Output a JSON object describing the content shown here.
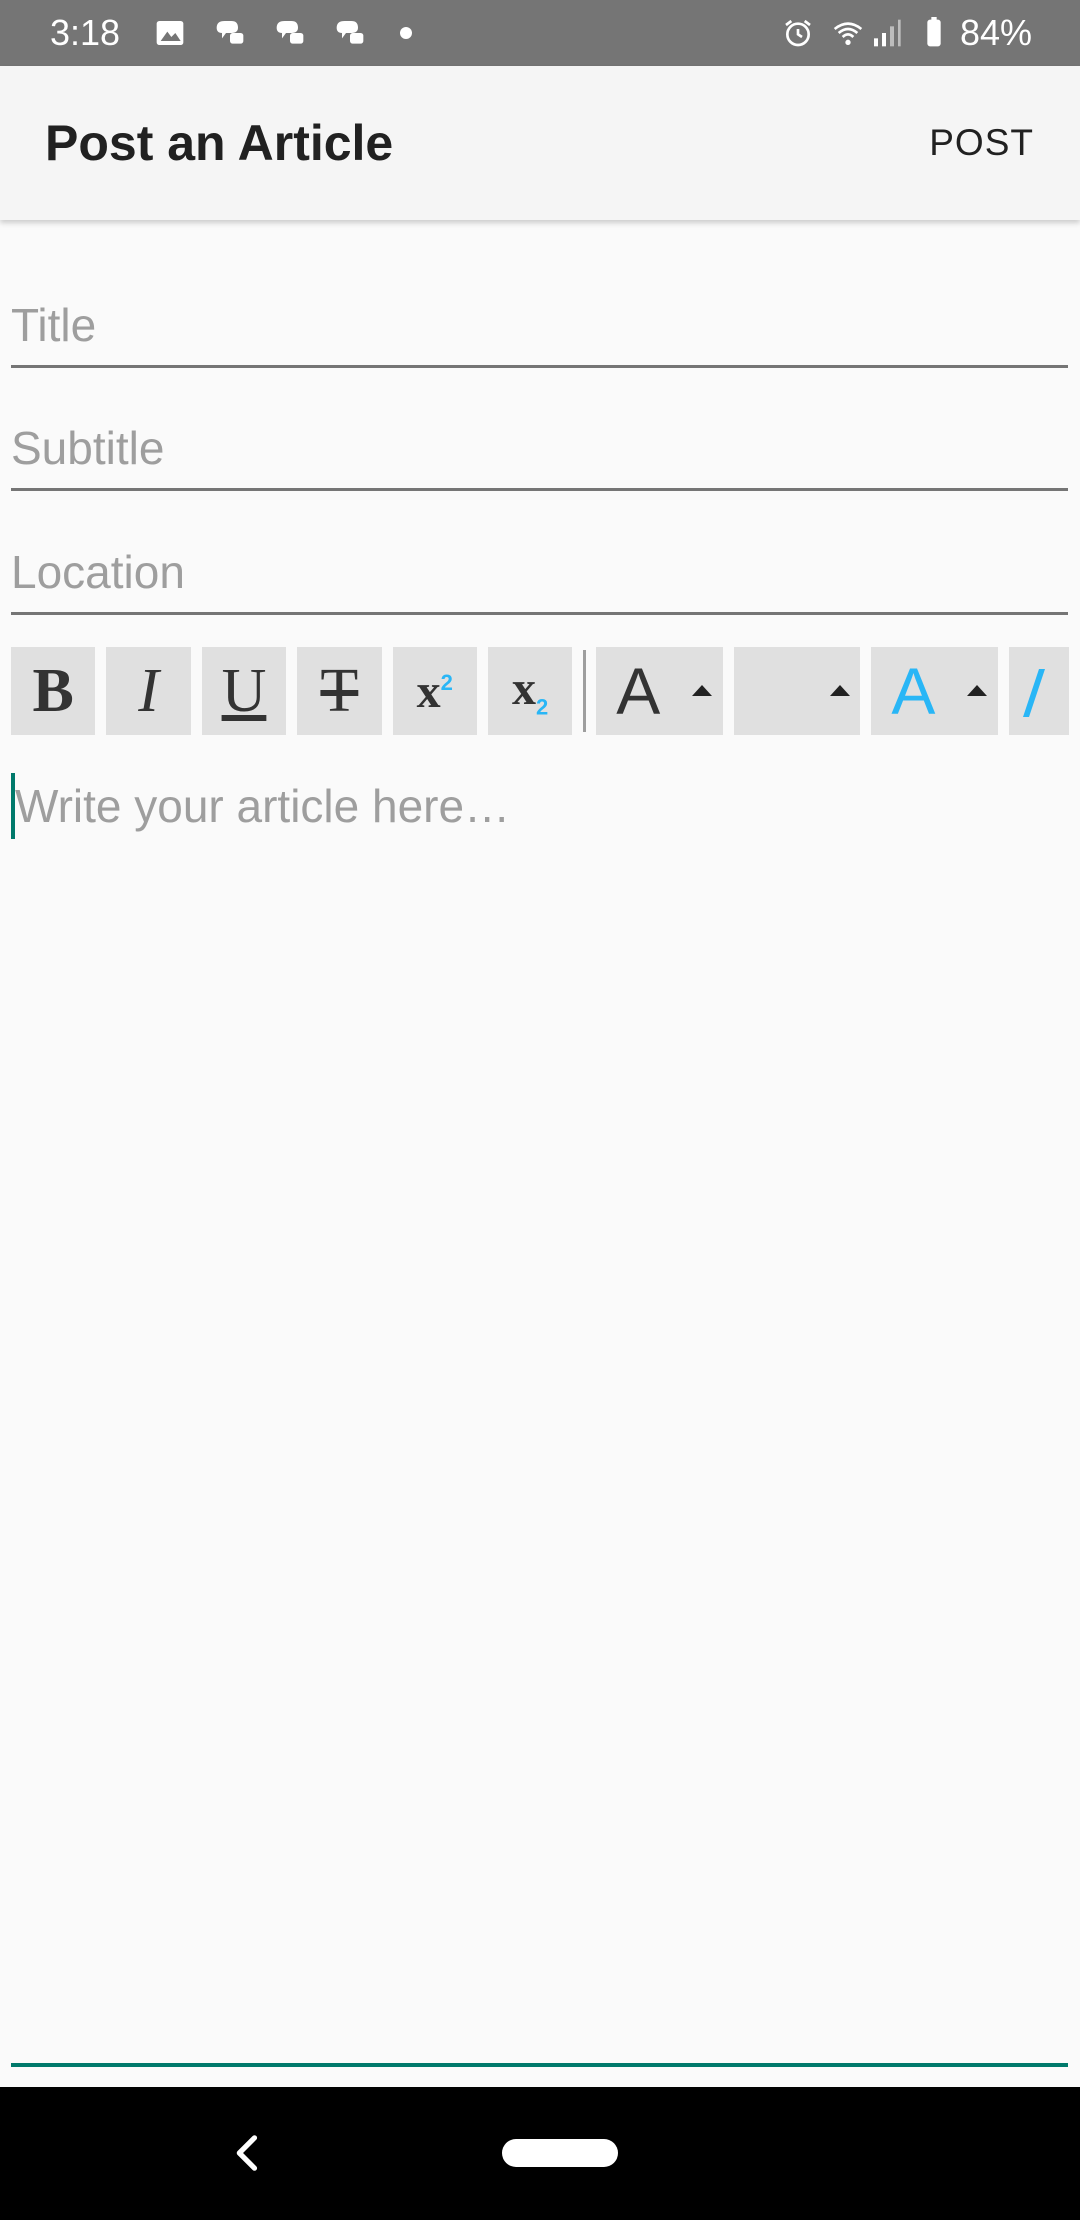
{
  "status_bar": {
    "time": "3:18",
    "battery_percent": "84%",
    "left_icons": [
      "image-icon",
      "chat-app-icon",
      "chat-app-icon",
      "chat-app-icon",
      "more-notifications-dot-icon"
    ],
    "right_icons": [
      "alarm-icon",
      "wifi-icon",
      "signal-icon",
      "battery-icon"
    ]
  },
  "app_bar": {
    "title": "Post an Article",
    "action_label": "POST"
  },
  "form": {
    "title_placeholder": "Title",
    "subtitle_placeholder": "Subtitle",
    "location_placeholder": "Location"
  },
  "toolbar": {
    "bold": "B",
    "italic": "I",
    "underline": "U",
    "strikethrough": "T",
    "superscript_base": "x",
    "superscript_mark": "2",
    "subscript_base": "x",
    "subscript_mark": "2",
    "font_color_glyph": "A",
    "highlight_glyph": "A",
    "accent_color": "#29b6f6"
  },
  "editor": {
    "placeholder": "Write your article here…",
    "focus_color": "#00796b"
  },
  "nav_bar": {
    "icons": [
      "back-icon",
      "home-pill-icon"
    ]
  }
}
